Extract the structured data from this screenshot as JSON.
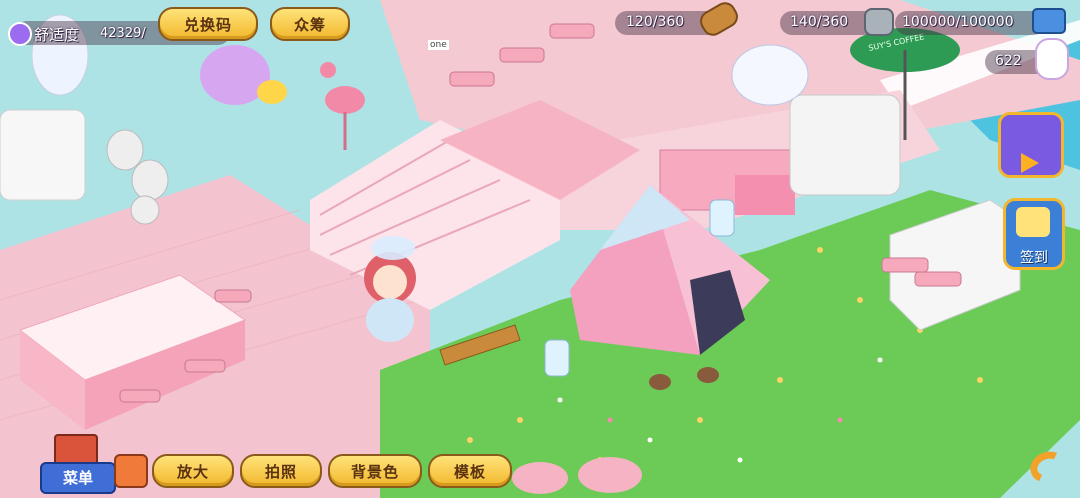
{
  "hud": {
    "comfort_label": "舒适度",
    "comfort_value": "42329/",
    "wood_value": "120/360",
    "stone_value": "140/360",
    "coin_value": "100000/100000",
    "bunny_value": "622"
  },
  "top_buttons": {
    "redeem_label": "兑换码",
    "crowdfund_label": "众筹"
  },
  "right_panel": {
    "checkin_label": "签到"
  },
  "bottom_bar": {
    "menu_label": "菜单",
    "zoom_label": "放大",
    "photo_label": "拍照",
    "background_label": "背景色",
    "template_label": "模板"
  },
  "scene": {
    "coffee_sign": "SUY'S COFFEE",
    "box_text": "one"
  },
  "colors": {
    "sky": "#aee3e6",
    "grass": "#6ccb56",
    "pink_floor": "#f3c4cf",
    "button_yellow": "#f2b72c"
  }
}
